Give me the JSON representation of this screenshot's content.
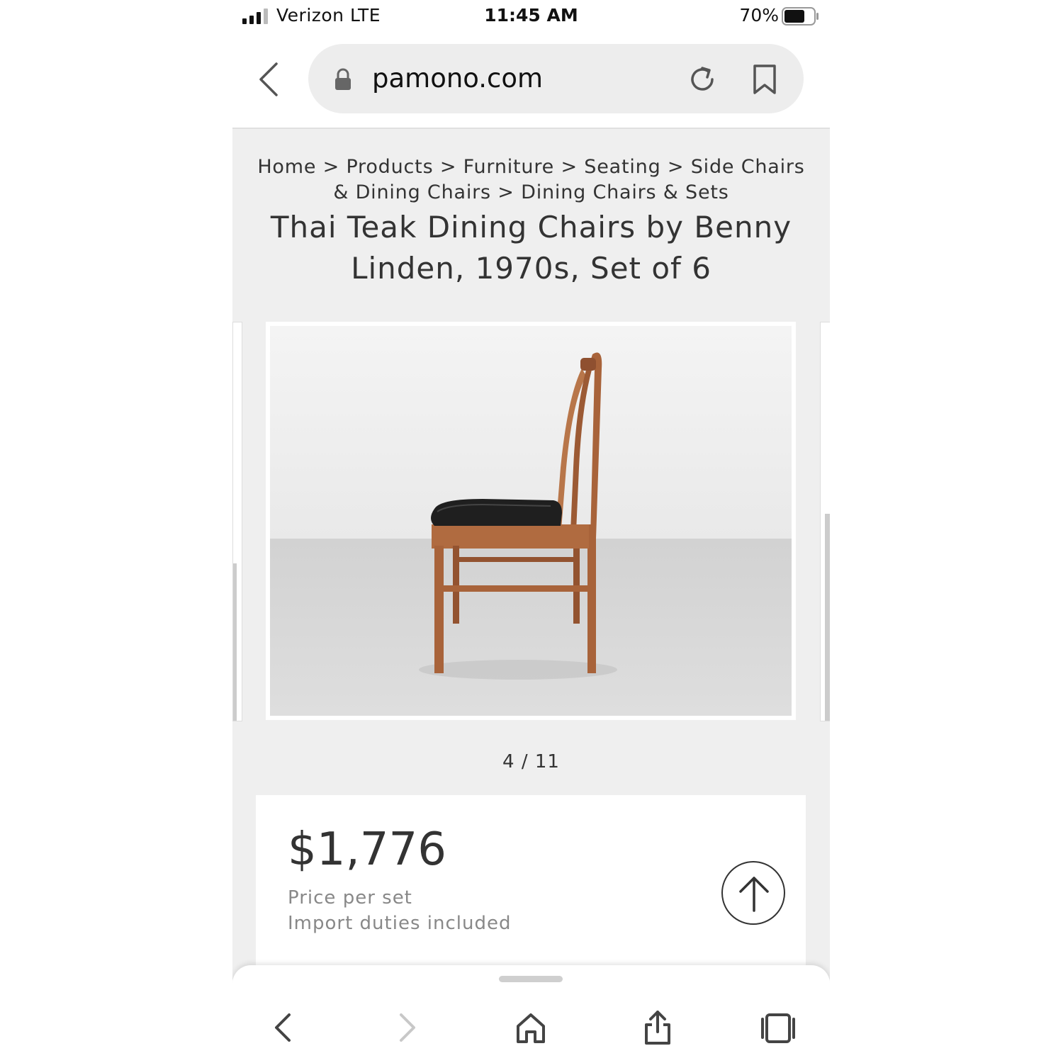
{
  "status_bar": {
    "carrier": "Verizon  LTE",
    "time": "11:45 AM",
    "battery": "70%",
    "battery_level": 0.7
  },
  "browser": {
    "url": "pamono.com",
    "icons": [
      "back-chevron-icon",
      "lock-icon",
      "reload-icon",
      "bookmark-icon"
    ]
  },
  "breadcrumb": {
    "items": [
      "Home",
      "Products",
      "Furniture",
      "Seating",
      "Side Chairs & Dining Chairs",
      "Dining Chairs & Sets"
    ],
    "separator": ">"
  },
  "product": {
    "title": "Thai Teak Dining Chairs by Benny Linden, 1970s, Set of 6",
    "image_counter": "4 / 11",
    "price": "$1,776",
    "price_note": "Price per set",
    "duties_note": "Import duties included"
  },
  "toolbar": {
    "icons": [
      "back-icon",
      "forward-icon",
      "home-icon",
      "share-icon",
      "tabs-icon"
    ]
  },
  "colors": {
    "page_bg": "#efefef",
    "text": "#333333",
    "muted": "#888888",
    "teak": "#a8633a",
    "seat": "#1f1f1f"
  }
}
